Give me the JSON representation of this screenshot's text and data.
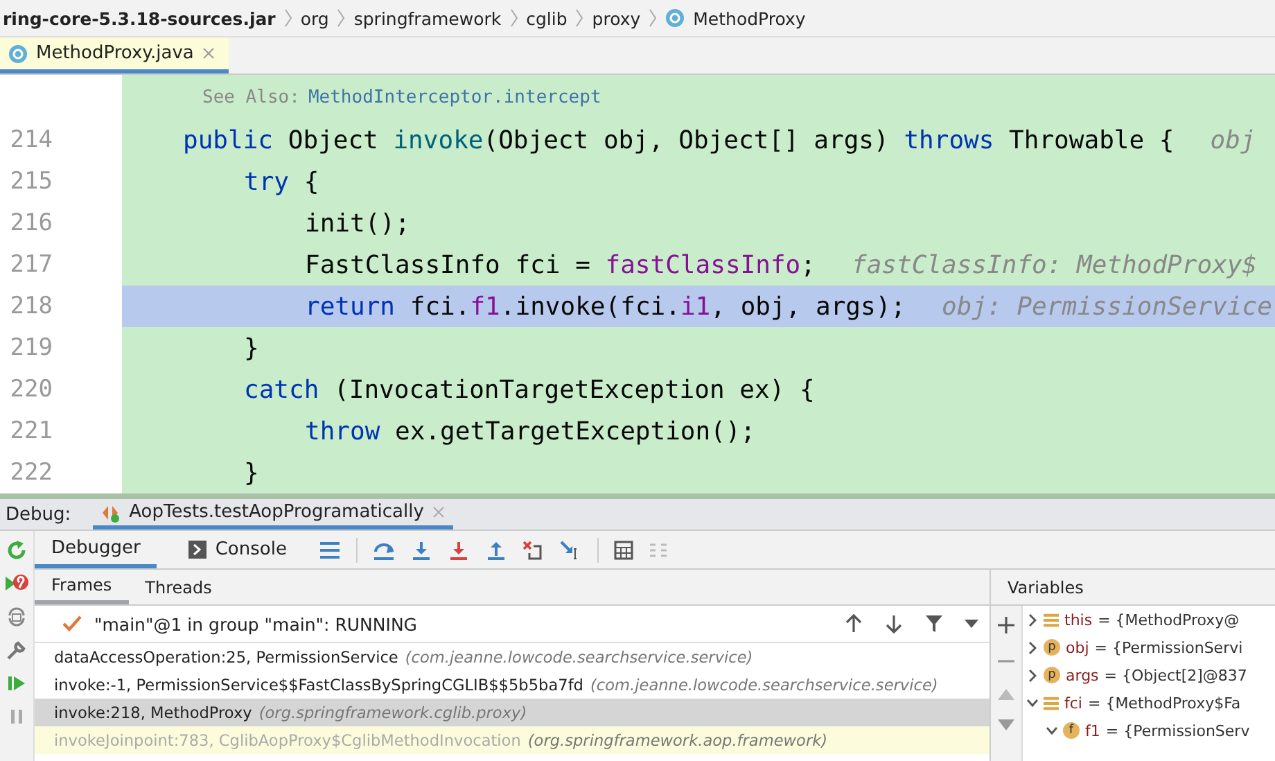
{
  "breadcrumbs": [
    {
      "label": "ring-core-5.3.18-sources.jar",
      "kind": "jar"
    },
    {
      "label": "org",
      "kind": "package"
    },
    {
      "label": "springframework",
      "kind": "package"
    },
    {
      "label": "cglib",
      "kind": "package"
    },
    {
      "label": "proxy",
      "kind": "package"
    },
    {
      "label": "MethodProxy",
      "kind": "class"
    }
  ],
  "editor_tabs": [
    {
      "label": "MethodProxy.java",
      "selected": true
    }
  ],
  "doc": {
    "label": "See Also:",
    "link": "MethodInterceptor.intercept"
  },
  "code_lines": [
    {
      "number": "214",
      "current": false,
      "tokens": [
        {
          "text": "public ",
          "kind": "keyword"
        },
        {
          "text": "Object ",
          "kind": "plain"
        },
        {
          "text": "invoke",
          "kind": "decl"
        },
        {
          "text": "(Object obj, Object[] args) ",
          "kind": "plain"
        },
        {
          "text": "throws ",
          "kind": "keyword"
        },
        {
          "text": "Throwable {",
          "kind": "plain"
        }
      ],
      "hint": "obj",
      "children": [
        {
          "number": "215",
          "current": false,
          "tokens": [
            {
              "text": "try ",
              "kind": "keyword"
            },
            {
              "text": "{",
              "kind": "plain"
            }
          ],
          "children": [
            {
              "number": "216",
              "current": false,
              "tokens": [
                {
                  "text": "init();",
                  "kind": "plain"
                }
              ]
            },
            {
              "number": "217",
              "current": false,
              "tokens": [
                {
                  "text": "FastClassInfo fci = ",
                  "kind": "plain"
                },
                {
                  "text": "fastClassInfo",
                  "kind": "field"
                },
                {
                  "text": ";",
                  "kind": "plain"
                }
              ],
              "hint": "fastClassInfo: MethodProxy$"
            },
            {
              "number": "218",
              "current": true,
              "tokens": [
                {
                  "text": "return ",
                  "kind": "keyword"
                },
                {
                  "text": "fci.",
                  "kind": "plain"
                },
                {
                  "text": "f1",
                  "kind": "field"
                },
                {
                  "text": ".invoke(fci.",
                  "kind": "plain"
                },
                {
                  "text": "i1",
                  "kind": "field"
                },
                {
                  "text": ", obj, args);",
                  "kind": "plain"
                }
              ],
              "hint": "obj: PermissionService"
            }
          ]
        },
        {
          "number": "219",
          "current": false,
          "tokens": [
            {
              "text": "}",
              "kind": "plain"
            }
          ]
        },
        {
          "number": "220",
          "current": false,
          "tokens": [
            {
              "text": "catch ",
              "kind": "keyword"
            },
            {
              "text": "(InvocationTargetException ex) {",
              "kind": "plain"
            }
          ],
          "children": [
            {
              "number": "221",
              "current": false,
              "tokens": [
                {
                  "text": "throw ",
                  "kind": "keyword"
                },
                {
                  "text": "ex.getTargetException();",
                  "kind": "plain"
                }
              ]
            }
          ]
        },
        {
          "number": "222",
          "current": false,
          "tokens": [
            {
              "text": "}",
              "kind": "plain"
            }
          ]
        }
      ]
    }
  ],
  "debug": {
    "label": "Debug:",
    "session": {
      "label": "AopTests.testAopProgramatically",
      "selected": true
    }
  },
  "debug_tabs": [
    {
      "label": "Debugger",
      "selected": true,
      "kind": "debugger"
    },
    {
      "label": "Console",
      "selected": false,
      "kind": "console"
    }
  ],
  "frames_tabs": [
    {
      "label": "Frames",
      "selected": true
    },
    {
      "label": "Threads",
      "selected": false
    }
  ],
  "thread": {
    "label": "\"main\"@1 in group \"main\": RUNNING"
  },
  "frames": [
    {
      "method": "dataAccessOperation:25, PermissionService",
      "package": "(com.jeanne.lowcode.searchservice.service)",
      "selected": false,
      "library": false
    },
    {
      "method": "invoke:-1, PermissionService$$FastClassBySpringCGLIB$$5b5ba7fd",
      "package": "(com.jeanne.lowcode.searchservice.service)",
      "selected": false,
      "library": false
    },
    {
      "method": "invoke:218, MethodProxy",
      "package": "(org.springframework.cglib.proxy)",
      "selected": true,
      "library": false
    },
    {
      "method": "invokeJoinpoint:783, CglibAopProxy$CglibMethodInvocation",
      "package": "(org.springframework.aop.framework)",
      "selected": false,
      "library": true
    }
  ],
  "variables": {
    "title": "Variables",
    "items": [
      {
        "name": "this",
        "value": "= {MethodProxy@",
        "kind": "object",
        "expanded": false
      },
      {
        "name": "obj",
        "value": "= {PermissionServi",
        "kind": "param",
        "badge": "p",
        "expanded": false
      },
      {
        "name": "args",
        "value": "= {Object[2]@837",
        "kind": "param",
        "badge": "p",
        "expanded": false
      },
      {
        "name": "fci",
        "value": "= {MethodProxy$Fa",
        "kind": "object",
        "expanded": true,
        "children": [
          {
            "name": "f1",
            "value": "= {PermissionServ",
            "kind": "field",
            "badge": "f",
            "expanded": true
          }
        ]
      }
    ]
  }
}
